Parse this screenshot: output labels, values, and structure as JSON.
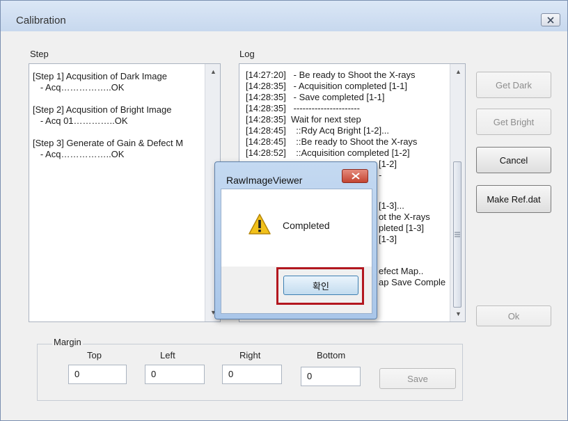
{
  "window": {
    "title": "Calibration",
    "close_icon": "close-icon"
  },
  "step": {
    "label": "Step",
    "lines": [
      "[Step 1] Acqusition of Dark Image",
      "   - Acq……………..OK",
      "[Step 2] Acqusition of Bright Image",
      "   - Acq 01…………..OK",
      "[Step 3] Generate of Gain & Defect M",
      "   - Acq……………..OK"
    ]
  },
  "log": {
    "label": "Log",
    "lines": [
      "[14:27:20]   - Be ready to Shoot the X-rays",
      "[14:28:35]   - Acquisition completed [1-1]",
      "[14:28:35]   - Save completed [1-1]",
      "[14:28:35]   ----------------------",
      "[14:28:35]  Wait for next step",
      "[14:28:45]    ::Rdy Acq Bright [1-2]...",
      "[14:28:45]    ::Be ready to Shoot the X-rays",
      "[14:28:52]    ::Acquisition completed [1-2]",
      "[1-2]",
      "-",
      "[1-3]...",
      "ot the X-rays",
      "pleted [1-3]",
      "[1-3]",
      "efect Map..",
      "ap Save Comple"
    ]
  },
  "buttons": {
    "get_dark": "Get Dark",
    "get_bright": "Get Bright",
    "cancel": "Cancel",
    "make_ref": "Make Ref.dat",
    "ok": "Ok",
    "save": "Save"
  },
  "margin": {
    "label": "Margin",
    "fields": [
      {
        "label": "Top",
        "value": "0"
      },
      {
        "label": "Left",
        "value": "0"
      },
      {
        "label": "Right",
        "value": "0"
      },
      {
        "label": "Bottom",
        "value": "0"
      }
    ]
  },
  "dialog": {
    "title": "RawImageViewer",
    "message": "Completed",
    "confirm_label": "확인",
    "icon": "warning-icon",
    "highlight_color": "#b3171f"
  }
}
